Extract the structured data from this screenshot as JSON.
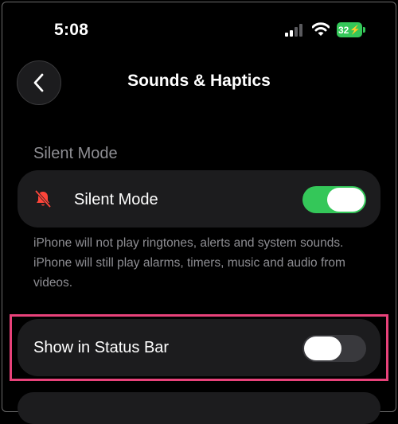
{
  "status_bar": {
    "time": "5:08",
    "battery": "32"
  },
  "nav": {
    "title": "Sounds & Haptics"
  },
  "silent_section": {
    "header": "Silent Mode",
    "silent_mode": {
      "label": "Silent Mode",
      "enabled": true
    },
    "footer": "iPhone will not play ringtones, alerts and system sounds. iPhone will still play alarms, timers, music and audio from videos."
  },
  "status_section": {
    "show_in_status_bar": {
      "label": "Show in Status Bar",
      "enabled": false
    }
  },
  "colors": {
    "accent_green": "#34c759",
    "bell_red": "#ff453a",
    "highlight": "#e8427a"
  },
  "icons": [
    "back-chevron-icon",
    "bell-slash-icon",
    "cellular-signal-icon",
    "wifi-icon",
    "battery-icon"
  ]
}
